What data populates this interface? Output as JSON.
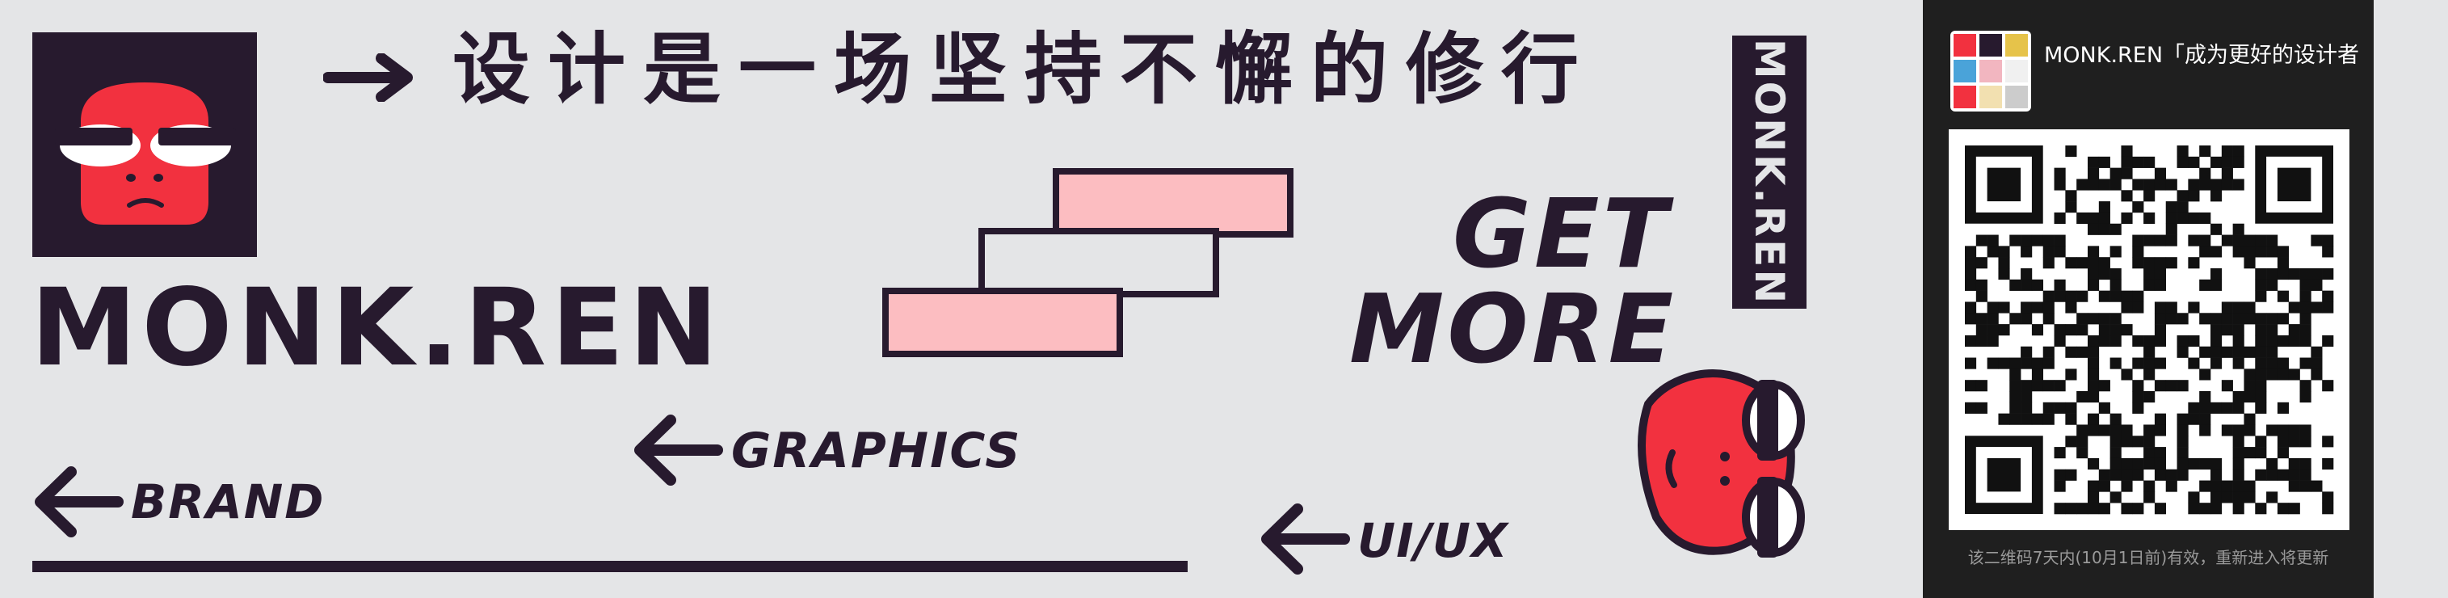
{
  "brand": {
    "name": "MONK.REN",
    "slogan": "设计是一场坚持不懈的修行",
    "vertical_badge": "MONK.REN"
  },
  "headline": {
    "line1": "GET",
    "line2": "MORE"
  },
  "categories": {
    "graphics": "GRAPHICS",
    "brand": "BRAND",
    "uiux": "UI/UX"
  },
  "qr": {
    "name": "MONK.REN「成为更好的设计者",
    "note": "该二维码7天内(10月1日前)有效，重新进入将更新"
  },
  "colors": {
    "background": "#e4e5e7",
    "ink": "#271a2e",
    "accent_red": "#f2313f",
    "accent_pink": "#fcbdc1",
    "panel": "#1f1f1f"
  },
  "icons": [
    "monkey-logo-icon",
    "monkey-face-icon",
    "arrow-right-icon",
    "arrow-left-icon",
    "qr-code-icon"
  ]
}
